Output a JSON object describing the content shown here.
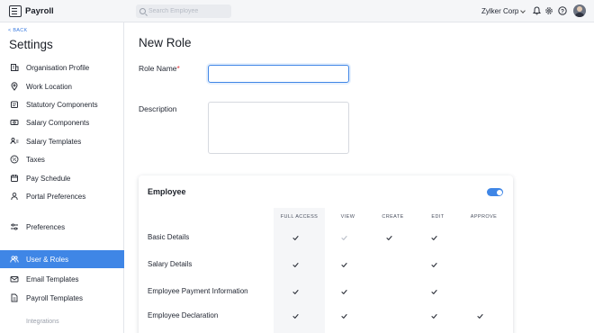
{
  "app": {
    "name": "Payroll"
  },
  "search": {
    "placeholder": "Search Employee"
  },
  "topbar": {
    "org_name": "Zylker Corp"
  },
  "sidebar": {
    "back_label": "< BACK",
    "title": "Settings",
    "items": [
      {
        "label": "Organisation Profile",
        "icon": "building-icon"
      },
      {
        "label": "Work Location",
        "icon": "location-pin-icon"
      },
      {
        "label": "Statutory Components",
        "icon": "shield-doc-icon"
      },
      {
        "label": "Salary Components",
        "icon": "money-icon"
      },
      {
        "label": "Salary Templates",
        "icon": "template-icon"
      },
      {
        "label": "Taxes",
        "icon": "percent-icon"
      },
      {
        "label": "Pay Schedule",
        "icon": "calendar-icon"
      },
      {
        "label": "Portal Preferences",
        "icon": "user-icon"
      },
      {
        "label": "Preferences",
        "icon": "sliders-icon"
      },
      {
        "label": "User & Roles",
        "icon": "users-icon",
        "active": true
      },
      {
        "label": "Email Templates",
        "icon": "mail-icon"
      },
      {
        "label": "Payroll Templates",
        "icon": "document-icon"
      }
    ],
    "footer_label": "Integrations"
  },
  "form": {
    "title": "New Role",
    "role_name_label": "Role Name",
    "role_name_required": "*",
    "role_name_value": "",
    "description_label": "Description",
    "description_value": ""
  },
  "permissions": {
    "section_title": "Employee",
    "section_enabled": true,
    "columns": [
      "FULL ACCESS",
      "VIEW",
      "CREATE",
      "EDIT",
      "APPROVE"
    ],
    "rows": [
      {
        "label": "Basic Details",
        "checks": [
          true,
          "disabled-checked",
          true,
          true,
          false
        ]
      },
      {
        "label": "Salary Details",
        "checks": [
          true,
          true,
          false,
          true,
          false
        ]
      },
      {
        "label": "Employee Payment Information",
        "checks": [
          true,
          true,
          false,
          true,
          false
        ]
      },
      {
        "label": "Employee Declaration",
        "checks": [
          true,
          true,
          false,
          true,
          true
        ]
      }
    ]
  },
  "colors": {
    "accent": "#3f86e6",
    "required": "#e0393e"
  }
}
